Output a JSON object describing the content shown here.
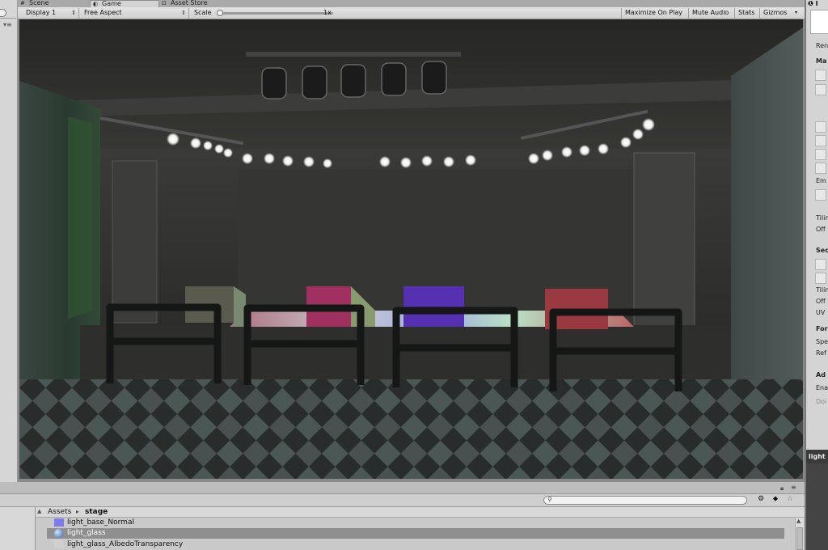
{
  "tabs": {
    "scene": "Scene",
    "game": "Game",
    "asset_store": "Asset Store"
  },
  "toolbar": {
    "display": "Display 1",
    "aspect": "Free Aspect",
    "scale_label": "Scale",
    "scale_value": "1x",
    "maximize": "Maximize On Play",
    "mute": "Mute Audio",
    "stats": "Stats",
    "gizmos": "Gizmos"
  },
  "inspector": {
    "header_fragment": "I",
    "labels": [
      "Ren",
      "Ma",
      "Em",
      "Tilin",
      "Off",
      "Sec",
      "Tilin",
      "Off",
      "UV",
      "For",
      "Spe",
      "Ref",
      "Ad",
      "Ena",
      "Doi"
    ],
    "bottom_label": "light"
  },
  "project": {
    "breadcrumb_root": "Assets",
    "breadcrumb_folder": "stage",
    "files": [
      {
        "name": "light_base_Normal",
        "icon": "texture-icon",
        "color": "#7c7cf0"
      },
      {
        "name": "light_glass",
        "icon": "material-icon",
        "color": "#4a7fc0"
      },
      {
        "name": "light_glass_AlbedoTransparency",
        "icon": "texture-icon",
        "color": "#cccccc"
      }
    ]
  },
  "colors": {
    "accent_purple": "#7c7cf0",
    "selected_row": "#8f8f8f"
  }
}
